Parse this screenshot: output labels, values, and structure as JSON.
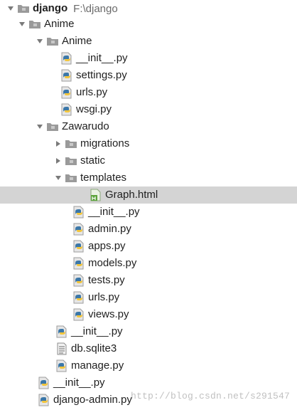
{
  "tree": {
    "items": [
      {
        "label": "django",
        "path": "F:\\django",
        "icon": "folder-icon",
        "arrow": "expanded",
        "bold": true
      },
      {
        "label": "Anime",
        "icon": "folder-icon",
        "arrow": "expanded"
      },
      {
        "label": "Anime",
        "icon": "folder-icon",
        "arrow": "expanded"
      },
      {
        "label": "__init__.py",
        "icon": "python-file-icon"
      },
      {
        "label": "settings.py",
        "icon": "python-file-icon"
      },
      {
        "label": "urls.py",
        "icon": "python-file-icon"
      },
      {
        "label": "wsgi.py",
        "icon": "python-file-icon"
      },
      {
        "label": "Zawarudo",
        "icon": "folder-icon",
        "arrow": "expanded"
      },
      {
        "label": "migrations",
        "icon": "folder-icon",
        "arrow": "collapsed"
      },
      {
        "label": "static",
        "icon": "folder-icon",
        "arrow": "collapsed"
      },
      {
        "label": "templates",
        "icon": "folder-icon",
        "arrow": "expanded"
      },
      {
        "label": "Graph.html",
        "icon": "html-file-icon",
        "selected": true
      },
      {
        "label": "__init__.py",
        "icon": "python-file-icon"
      },
      {
        "label": "admin.py",
        "icon": "python-file-icon"
      },
      {
        "label": "apps.py",
        "icon": "python-file-icon"
      },
      {
        "label": "models.py",
        "icon": "python-file-icon"
      },
      {
        "label": "tests.py",
        "icon": "python-file-icon"
      },
      {
        "label": "urls.py",
        "icon": "python-file-icon"
      },
      {
        "label": "views.py",
        "icon": "python-file-icon"
      },
      {
        "label": "__init__.py",
        "icon": "python-file-icon"
      },
      {
        "label": "db.sqlite3",
        "icon": "text-file-icon"
      },
      {
        "label": "manage.py",
        "icon": "python-file-icon"
      },
      {
        "label": "__init__.py",
        "icon": "python-file-icon"
      },
      {
        "label": "django-admin.py",
        "icon": "python-file-icon"
      }
    ]
  },
  "watermark": "http://blog.csdn.net/s291547"
}
